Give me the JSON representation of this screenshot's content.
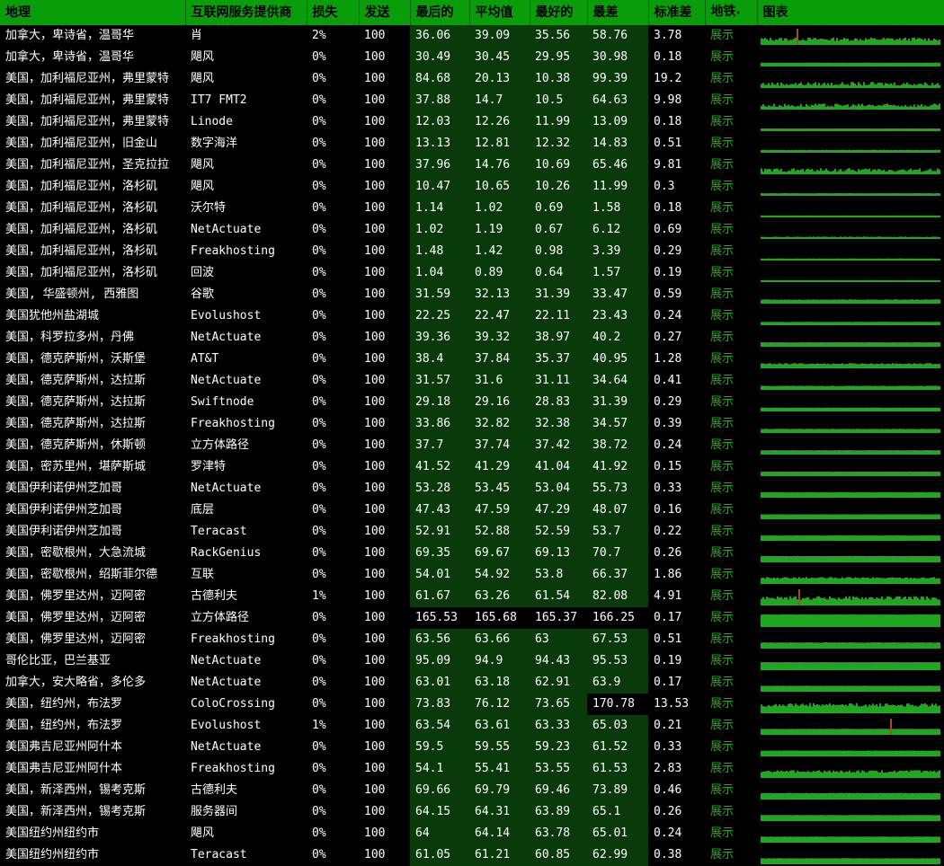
{
  "headers": {
    "location": "地理",
    "provider": "互联网服务提供商",
    "loss": "损失",
    "sent": "发送",
    "last": "最后的",
    "avg": "平均值",
    "best": "最好的",
    "worst": "最差",
    "stdev": "标准差",
    "map": "地铁",
    "map_caret": "▾",
    "chart": "图表"
  },
  "link_label": "展示",
  "colors": {
    "header_bg": "#0a9d0a",
    "dark_cell_bg": "#0a3a0a",
    "link": "#18b018",
    "graph_bar": "#1fa81f",
    "graph_spike": "#a05020"
  },
  "rows": [
    {
      "location": "加拿大，卑诗省，温哥华",
      "provider": "肖",
      "loss": "2%",
      "sent": "100",
      "last": "36.06",
      "avg": "39.09",
      "best": "35.56",
      "worst": "58.76",
      "stdev": "3.78",
      "map": "展示"
    },
    {
      "location": "加拿大，卑诗省，温哥华",
      "provider": "飓风",
      "loss": "0%",
      "sent": "100",
      "last": "30.49",
      "avg": "30.45",
      "best": "29.95",
      "worst": "30.98",
      "stdev": "0.18",
      "map": "展示"
    },
    {
      "location": "美国，加利福尼亚州，弗里蒙特",
      "provider": "飓风",
      "loss": "0%",
      "sent": "100",
      "last": "84.68",
      "avg": "20.13",
      "best": "10.38",
      "worst": "99.39",
      "stdev": "19.2",
      "map": "展示"
    },
    {
      "location": "美国，加利福尼亚州，弗里蒙特",
      "provider": "IT7 FMT2",
      "loss": "0%",
      "sent": "100",
      "last": "37.88",
      "avg": "14.7",
      "best": "10.5",
      "worst": "64.63",
      "stdev": "9.98",
      "map": "展示"
    },
    {
      "location": "美国，加利福尼亚州，弗里蒙特",
      "provider": "Linode",
      "loss": "0%",
      "sent": "100",
      "last": "12.03",
      "avg": "12.26",
      "best": "11.99",
      "worst": "13.09",
      "stdev": "0.18",
      "map": "展示"
    },
    {
      "location": "美国，加利福尼亚州，旧金山",
      "provider": "数字海洋",
      "loss": "0%",
      "sent": "100",
      "last": "13.13",
      "avg": "12.81",
      "best": "12.32",
      "worst": "14.83",
      "stdev": "0.51",
      "map": "展示"
    },
    {
      "location": "美国，加利福尼亚州，圣克拉拉",
      "provider": "飓风",
      "loss": "0%",
      "sent": "100",
      "last": "37.96",
      "avg": "14.76",
      "best": "10.69",
      "worst": "65.46",
      "stdev": "9.81",
      "map": "展示"
    },
    {
      "location": "美国，加利福尼亚州，洛杉矶",
      "provider": "飓风",
      "loss": "0%",
      "sent": "100",
      "last": "10.47",
      "avg": "10.65",
      "best": "10.26",
      "worst": "11.99",
      "stdev": "0.3",
      "map": "展示"
    },
    {
      "location": "美国，加利福尼亚州，洛杉矶",
      "provider": "沃尔特",
      "loss": "0%",
      "sent": "100",
      "last": "1.14",
      "avg": "1.02",
      "best": "0.69",
      "worst": "1.58",
      "stdev": "0.18",
      "map": "展示"
    },
    {
      "location": "美国，加利福尼亚州，洛杉矶",
      "provider": "NetActuate",
      "loss": "0%",
      "sent": "100",
      "last": "1.02",
      "avg": "1.19",
      "best": "0.67",
      "worst": "6.12",
      "stdev": "0.69",
      "map": "展示"
    },
    {
      "location": "美国，加利福尼亚州，洛杉矶",
      "provider": "Freakhosting",
      "loss": "0%",
      "sent": "100",
      "last": "1.48",
      "avg": "1.42",
      "best": "0.98",
      "worst": "3.39",
      "stdev": "0.29",
      "map": "展示"
    },
    {
      "location": "美国，加利福尼亚州，洛杉矶",
      "provider": "回波",
      "loss": "0%",
      "sent": "100",
      "last": "1.04",
      "avg": "0.89",
      "best": "0.64",
      "worst": "1.57",
      "stdev": "0.19",
      "map": "展示"
    },
    {
      "location": "美国, 华盛顿州, 西雅图",
      "provider": "谷歌",
      "loss": "0%",
      "sent": "100",
      "last": "31.59",
      "avg": "32.13",
      "best": "31.39",
      "worst": "33.47",
      "stdev": "0.59",
      "map": "展示"
    },
    {
      "location": "美国犹他州盐湖城",
      "provider": "Evolushost",
      "loss": "0%",
      "sent": "100",
      "last": "22.25",
      "avg": "22.47",
      "best": "22.11",
      "worst": "23.43",
      "stdev": "0.24",
      "map": "展示"
    },
    {
      "location": "美国，科罗拉多州，丹佛",
      "provider": "NetActuate",
      "loss": "0%",
      "sent": "100",
      "last": "39.36",
      "avg": "39.32",
      "best": "38.97",
      "worst": "40.2",
      "stdev": "0.27",
      "map": "展示"
    },
    {
      "location": "美国，德克萨斯州，沃斯堡",
      "provider": "AT&T",
      "loss": "0%",
      "sent": "100",
      "last": "38.4",
      "avg": "37.84",
      "best": "35.37",
      "worst": "40.95",
      "stdev": "1.28",
      "map": "展示"
    },
    {
      "location": "美国，德克萨斯州，达拉斯",
      "provider": "NetActuate",
      "loss": "0%",
      "sent": "100",
      "last": "31.57",
      "avg": "31.6",
      "best": "31.11",
      "worst": "34.64",
      "stdev": "0.41",
      "map": "展示"
    },
    {
      "location": "美国，德克萨斯州，达拉斯",
      "provider": "Swiftnode",
      "loss": "0%",
      "sent": "100",
      "last": "29.18",
      "avg": "29.16",
      "best": "28.83",
      "worst": "31.39",
      "stdev": "0.29",
      "map": "展示"
    },
    {
      "location": "美国，德克萨斯州，达拉斯",
      "provider": "Freakhosting",
      "loss": "0%",
      "sent": "100",
      "last": "33.86",
      "avg": "32.82",
      "best": "32.38",
      "worst": "34.57",
      "stdev": "0.39",
      "map": "展示"
    },
    {
      "location": "美国，德克萨斯州，休斯顿",
      "provider": "立方体路径",
      "loss": "0%",
      "sent": "100",
      "last": "37.7",
      "avg": "37.74",
      "best": "37.42",
      "worst": "38.72",
      "stdev": "0.24",
      "map": "展示"
    },
    {
      "location": "美国，密苏里州，堪萨斯城",
      "provider": "罗津特",
      "loss": "0%",
      "sent": "100",
      "last": "41.52",
      "avg": "41.29",
      "best": "41.04",
      "worst": "41.92",
      "stdev": "0.15",
      "map": "展示"
    },
    {
      "location": "美国伊利诺伊州芝加哥",
      "provider": "NetActuate",
      "loss": "0%",
      "sent": "100",
      "last": "53.28",
      "avg": "53.45",
      "best": "53.04",
      "worst": "55.73",
      "stdev": "0.33",
      "map": "展示"
    },
    {
      "location": "美国伊利诺伊州芝加哥",
      "provider": "底层",
      "loss": "0%",
      "sent": "100",
      "last": "47.43",
      "avg": "47.59",
      "best": "47.29",
      "worst": "48.07",
      "stdev": "0.16",
      "map": "展示"
    },
    {
      "location": "美国伊利诺伊州芝加哥",
      "provider": "Teracast",
      "loss": "0%",
      "sent": "100",
      "last": "52.91",
      "avg": "52.88",
      "best": "52.59",
      "worst": "53.7",
      "stdev": "0.22",
      "map": "展示"
    },
    {
      "location": "美国，密歇根州，大急流城",
      "provider": "RackGenius",
      "loss": "0%",
      "sent": "100",
      "last": "69.35",
      "avg": "69.67",
      "best": "69.13",
      "worst": "70.7",
      "stdev": "0.26",
      "map": "展示"
    },
    {
      "location": "美国，密歇根州，绍斯菲尔德",
      "provider": "互联",
      "loss": "0%",
      "sent": "100",
      "last": "54.01",
      "avg": "54.92",
      "best": "53.8",
      "worst": "66.37",
      "stdev": "1.86",
      "map": "展示"
    },
    {
      "location": "美国，佛罗里达州，迈阿密",
      "provider": "古德利夫",
      "loss": "1%",
      "sent": "100",
      "last": "61.67",
      "avg": "63.26",
      "best": "61.54",
      "worst": "82.08",
      "stdev": "4.91",
      "map": "展示"
    },
    {
      "location": "美国，佛罗里达州，迈阿密",
      "provider": "立方体路径",
      "loss": "0%",
      "sent": "100",
      "last": "165.53",
      "avg": "165.68",
      "best": "165.37",
      "worst": "166.25",
      "stdev": "0.17",
      "map": "展示"
    },
    {
      "location": "美国，佛罗里达州，迈阿密",
      "provider": "Freakhosting",
      "loss": "0%",
      "sent": "100",
      "last": "63.56",
      "avg": "63.66",
      "best": "63",
      "worst": "67.53",
      "stdev": "0.51",
      "map": "展示"
    },
    {
      "location": "哥伦比亚，巴兰基亚",
      "provider": "NetActuate",
      "loss": "0%",
      "sent": "100",
      "last": "95.09",
      "avg": "94.9",
      "best": "94.43",
      "worst": "95.53",
      "stdev": "0.19",
      "map": "展示"
    },
    {
      "location": "加拿大，安大略省，多伦多",
      "provider": "NetActuate",
      "loss": "0%",
      "sent": "100",
      "last": "63.01",
      "avg": "63.18",
      "best": "62.91",
      "worst": "63.9",
      "stdev": "0.17",
      "map": "展示"
    },
    {
      "location": "美国，纽约州，布法罗",
      "provider": "ColoCrossing",
      "loss": "0%",
      "sent": "100",
      "last": "73.83",
      "avg": "76.12",
      "best": "73.65",
      "worst": "170.78",
      "stdev": "13.53",
      "map": "展示"
    },
    {
      "location": "美国，纽约州，布法罗",
      "provider": "Evolushost",
      "loss": "1%",
      "sent": "100",
      "last": "63.54",
      "avg": "63.61",
      "best": "63.33",
      "worst": "65.03",
      "stdev": "0.21",
      "map": "展示"
    },
    {
      "location": "美国弗吉尼亚州阿什本",
      "provider": "NetActuate",
      "loss": "0%",
      "sent": "100",
      "last": "59.5",
      "avg": "59.55",
      "best": "59.23",
      "worst": "61.52",
      "stdev": "0.33",
      "map": "展示"
    },
    {
      "location": "美国弗吉尼亚州阿什本",
      "provider": "Freakhosting",
      "loss": "0%",
      "sent": "100",
      "last": "54.1",
      "avg": "55.41",
      "best": "53.55",
      "worst": "61.53",
      "stdev": "2.83",
      "map": "展示"
    },
    {
      "location": "美国，新泽西州，锡考克斯",
      "provider": "古德利夫",
      "loss": "0%",
      "sent": "100",
      "last": "69.66",
      "avg": "69.79",
      "best": "69.46",
      "worst": "73.89",
      "stdev": "0.46",
      "map": "展示"
    },
    {
      "location": "美国，新泽西州，锡考克斯",
      "provider": "服务器间",
      "loss": "0%",
      "sent": "100",
      "last": "64.15",
      "avg": "64.31",
      "best": "63.89",
      "worst": "65.1",
      "stdev": "0.26",
      "map": "展示"
    },
    {
      "location": "美国纽约州纽约市",
      "provider": "飓风",
      "loss": "0%",
      "sent": "100",
      "last": "64",
      "avg": "64.14",
      "best": "63.78",
      "worst": "65.01",
      "stdev": "0.24",
      "map": "展示"
    },
    {
      "location": "美国纽约州纽约市",
      "provider": "Teracast",
      "loss": "0%",
      "sent": "100",
      "last": "61.05",
      "avg": "61.21",
      "best": "60.85",
      "worst": "62.99",
      "stdev": "0.38",
      "map": "展示"
    }
  ]
}
